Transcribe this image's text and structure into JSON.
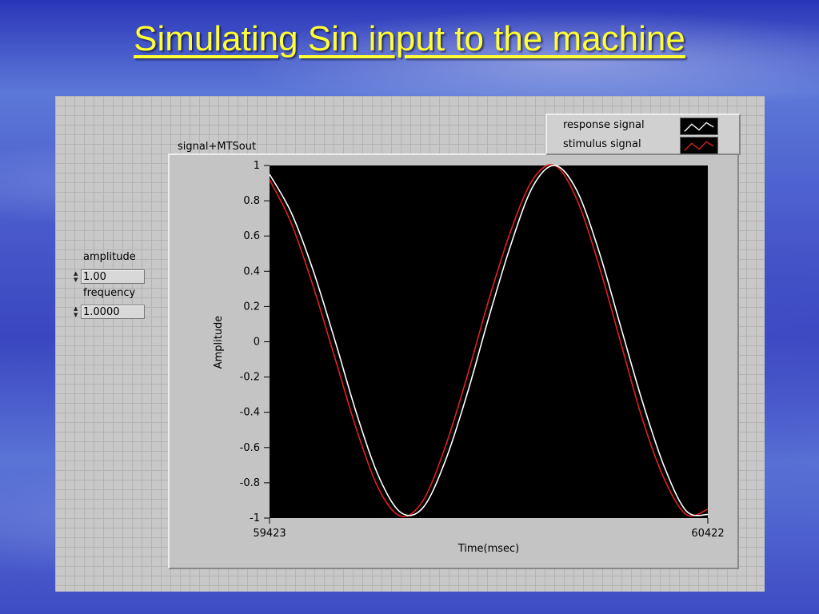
{
  "slide": {
    "title": "Simulating Sin input to the machine"
  },
  "controls": {
    "amplitude": {
      "label": "amplitude",
      "value": "1.00"
    },
    "frequency": {
      "label": "frequency",
      "value": "1.0000"
    }
  },
  "graph": {
    "label": "signal+MTSout"
  },
  "colors": {
    "response": "#ffffff",
    "stimulus": "#e02020",
    "plot_bg": "#000000",
    "title": "#ffff33"
  },
  "chart_data": {
    "type": "line",
    "title": "signal+MTSout",
    "xlabel": "Time(msec)",
    "ylabel": "Amplitude",
    "xlim": [
      59423,
      60422
    ],
    "ylim": [
      -1,
      1
    ],
    "x_ticks": [
      "59423",
      "60422"
    ],
    "y_ticks": [
      "1",
      "0.8",
      "0.6",
      "0.4",
      "0.2",
      "0",
      "-0.2",
      "-0.4",
      "-0.6",
      "-0.8",
      "-1"
    ],
    "grid": false,
    "legend_position": "top-right",
    "x": [
      59423,
      59473,
      59523,
      59573,
      59623,
      59673,
      59723,
      59773,
      59823,
      59873,
      59923,
      59973,
      60023,
      60073,
      60123,
      60173,
      60223,
      60273,
      60323,
      60373,
      60422
    ],
    "series": [
      {
        "name": "response signal",
        "color": "#ffffff",
        "values": [
          0.95,
          0.73,
          0.4,
          0.0,
          -0.42,
          -0.77,
          -0.97,
          -0.94,
          -0.68,
          -0.3,
          0.14,
          0.55,
          0.88,
          1.0,
          0.86,
          0.52,
          0.09,
          -0.34,
          -0.71,
          -0.96,
          -0.98
        ]
      },
      {
        "name": "stimulus signal",
        "color": "#e02020",
        "values": [
          0.92,
          0.67,
          0.31,
          -0.1,
          -0.51,
          -0.84,
          -0.99,
          -0.9,
          -0.6,
          -0.2,
          0.24,
          0.63,
          0.92,
          1.0,
          0.81,
          0.44,
          0.0,
          -0.44,
          -0.78,
          -0.98,
          -0.95
        ]
      }
    ]
  }
}
